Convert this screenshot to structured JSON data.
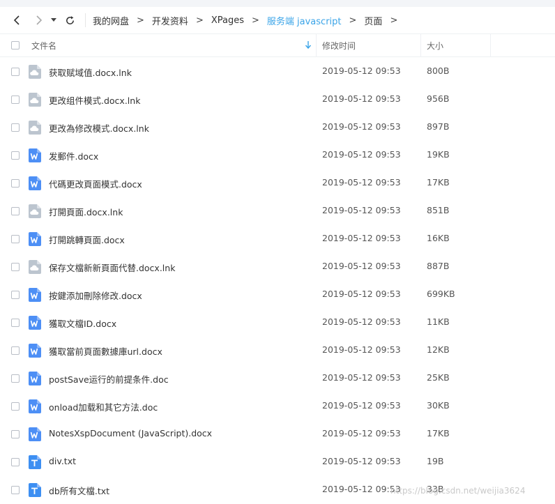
{
  "nav": {
    "back_icon": "chevron-left-icon",
    "forward_icon": "chevron-right-icon",
    "history_icon": "caret-down-icon",
    "refresh_icon": "refresh-icon"
  },
  "breadcrumb": [
    {
      "label": "我的网盘"
    },
    {
      "label": "开发资料"
    },
    {
      "label": "XPages"
    },
    {
      "label": "服务端 javascript",
      "active": true
    },
    {
      "label": "页面"
    }
  ],
  "header": {
    "name": "文件名",
    "modified": "修改时间",
    "size": "大小",
    "sort_icon": "arrow-down-icon"
  },
  "colors": {
    "accent": "#3aa4e8",
    "word_icon": "#4d8ff5",
    "text_icon": "#3d8ff2",
    "shortcut_icon": "#bcc5cf"
  },
  "files": [
    {
      "name": "获取赋域值.docx.lnk",
      "date": "2019-05-12 09:53",
      "size": "800B",
      "icon": "shortcut-file-icon"
    },
    {
      "name": "更改组件模式.docx.lnk",
      "date": "2019-05-12 09:53",
      "size": "956B",
      "icon": "shortcut-file-icon"
    },
    {
      "name": "更改為修改模式.docx.lnk",
      "date": "2019-05-12 09:53",
      "size": "897B",
      "icon": "shortcut-file-icon"
    },
    {
      "name": "发郵件.docx",
      "date": "2019-05-12 09:53",
      "size": "19KB",
      "icon": "word-file-icon"
    },
    {
      "name": "代碼更改頁面模式.docx",
      "date": "2019-05-12 09:53",
      "size": "17KB",
      "icon": "word-file-icon"
    },
    {
      "name": "打開頁面.docx.lnk",
      "date": "2019-05-12 09:53",
      "size": "851B",
      "icon": "shortcut-file-icon"
    },
    {
      "name": "打開跳轉頁面.docx",
      "date": "2019-05-12 09:53",
      "size": "16KB",
      "icon": "word-file-icon"
    },
    {
      "name": "保存文檔新新頁面代替.docx.lnk",
      "date": "2019-05-12 09:53",
      "size": "887B",
      "icon": "shortcut-file-icon"
    },
    {
      "name": "按鍵添加刪除修改.docx",
      "date": "2019-05-12 09:53",
      "size": "699KB",
      "icon": "word-file-icon"
    },
    {
      "name": "獲取文檔ID.docx",
      "date": "2019-05-12 09:53",
      "size": "11KB",
      "icon": "word-file-icon"
    },
    {
      "name": "獲取當前頁面數據庫url.docx",
      "date": "2019-05-12 09:53",
      "size": "12KB",
      "icon": "word-file-icon"
    },
    {
      "name": "postSave运行的前提条件.doc",
      "date": "2019-05-12 09:53",
      "size": "25KB",
      "icon": "word-file-icon"
    },
    {
      "name": "onload加载和其它方法.doc",
      "date": "2019-05-12 09:53",
      "size": "30KB",
      "icon": "word-file-icon"
    },
    {
      "name": "NotesXspDocument (JavaScript).docx",
      "date": "2019-05-12 09:53",
      "size": "17KB",
      "icon": "word-file-icon"
    },
    {
      "name": "div.txt",
      "date": "2019-05-12 09:53",
      "size": "19B",
      "icon": "text-file-icon"
    },
    {
      "name": "db所有文檔.txt",
      "date": "2019-05-12 09:53",
      "size": "33B",
      "icon": "text-file-icon"
    }
  ],
  "watermark": "https://blog.csdn.net/weijia3624"
}
